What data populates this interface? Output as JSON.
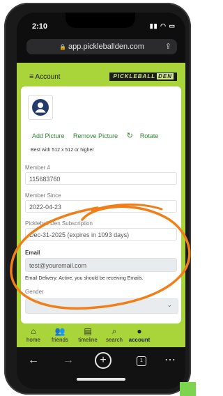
{
  "status": {
    "time": "2:10"
  },
  "browser": {
    "url": "app.pickleballden.com"
  },
  "header": {
    "menu_label": "Account",
    "logo_text": "PICKLEBALL",
    "logo_den": "DEN"
  },
  "picture": {
    "add_label": "Add Picture",
    "remove_label": "Remove Picture",
    "rotate_label": "Rotate",
    "hint": "Best with 512 x 512 or higher"
  },
  "fields": {
    "member_no_label": "Member #",
    "member_no_value": "115683760",
    "member_since_label": "Member Since",
    "member_since_value": "2022-04-23",
    "subscription_label": "Pickleball Den Subscription",
    "subscription_value": "Dec-31-2025 (expires in 1093 days)",
    "email_label": "Email",
    "email_value": "test@youremail.com",
    "email_delivery": "Email Delivery: Active, you should be receiving Emails.",
    "gender_label": "Gender"
  },
  "tabs": [
    {
      "label": "home",
      "icon": "home-icon"
    },
    {
      "label": "friends",
      "icon": "friends-icon"
    },
    {
      "label": "timeline",
      "icon": "timeline-icon"
    },
    {
      "label": "search",
      "icon": "search-icon"
    },
    {
      "label": "account",
      "icon": "account-icon"
    }
  ],
  "colors": {
    "brand_green": "#a9d43a",
    "link_green": "#2e8a2e",
    "annotation_orange": "#f07f1a"
  }
}
